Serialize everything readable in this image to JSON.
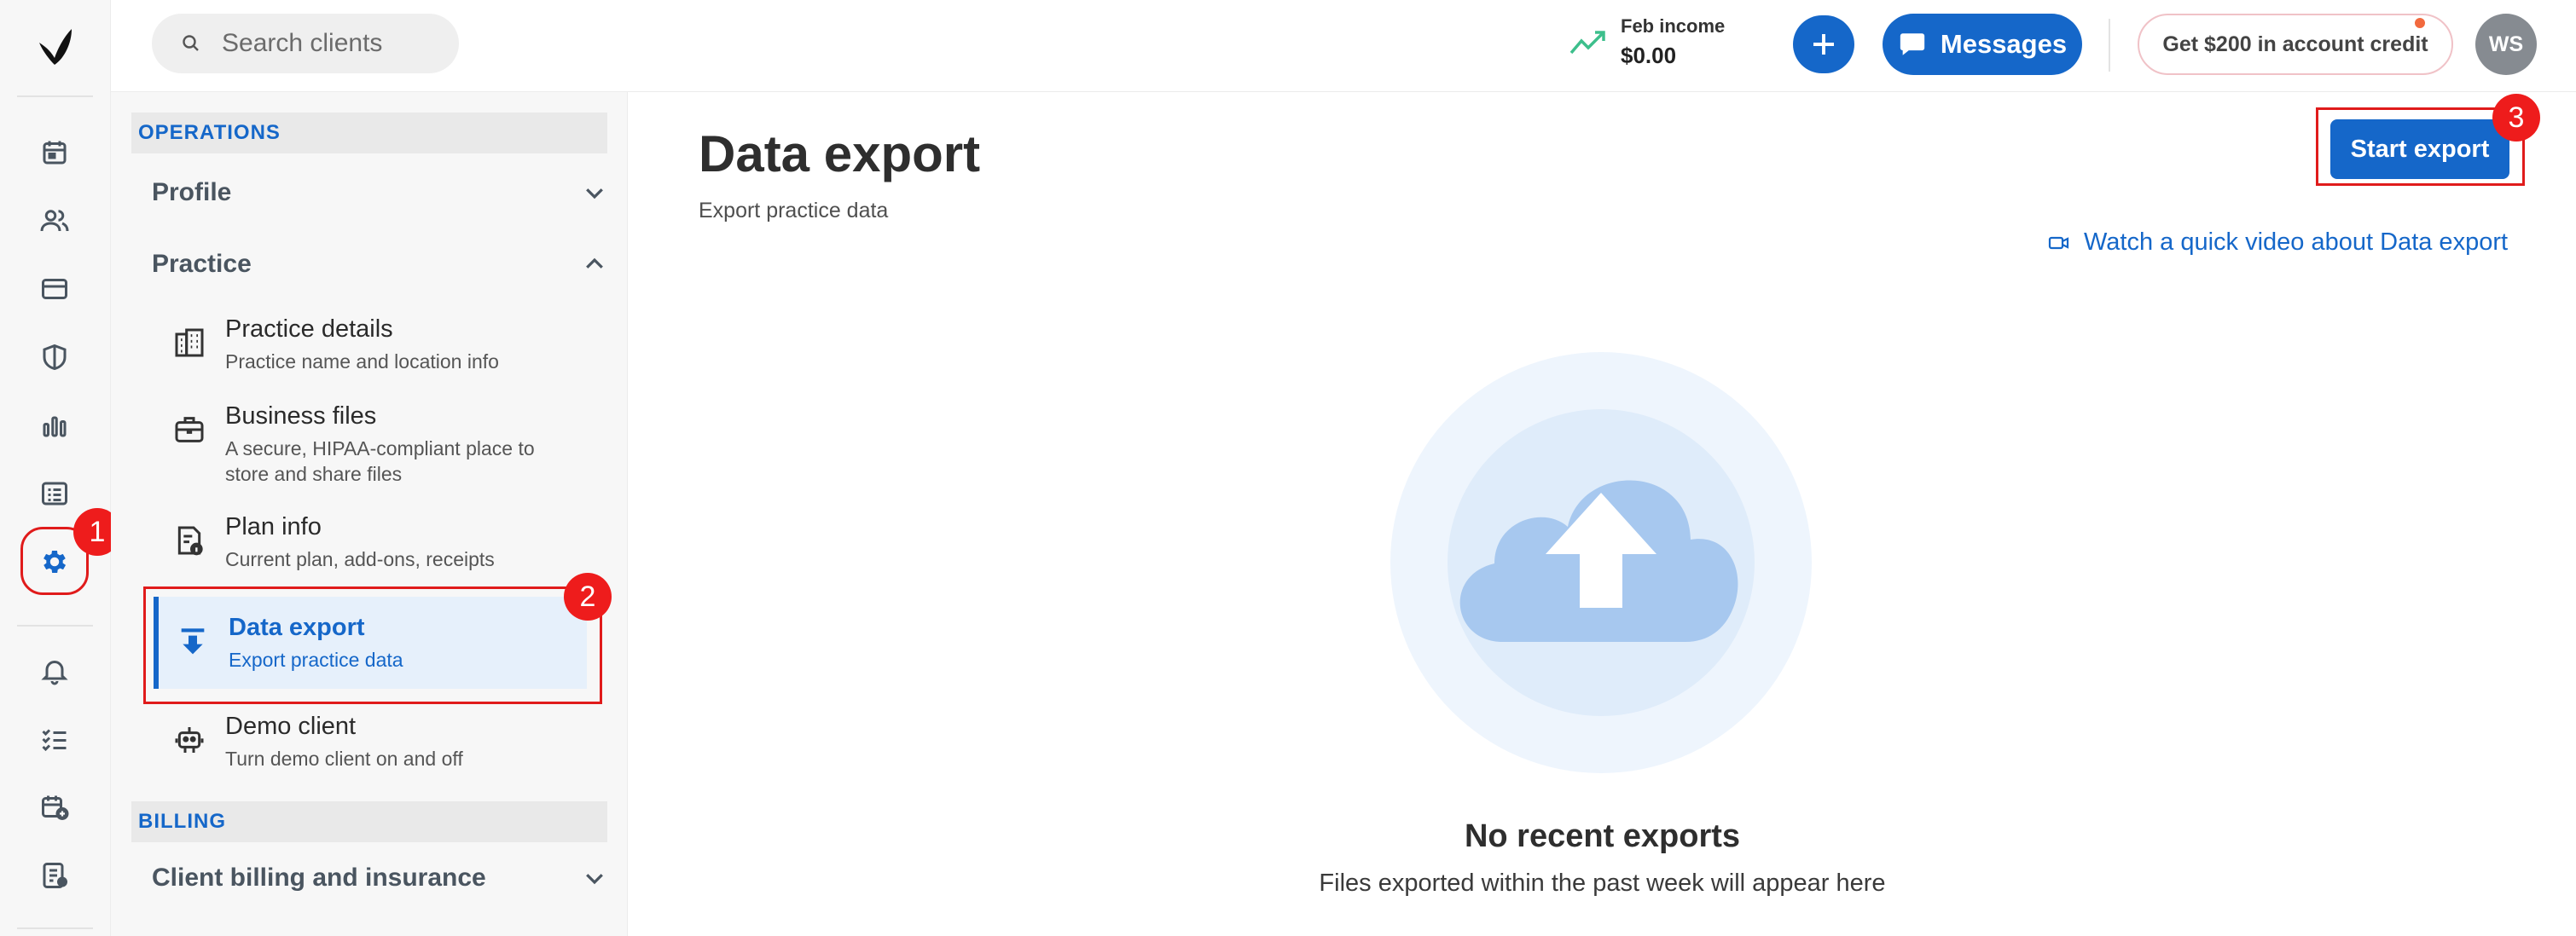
{
  "topbar": {
    "search_placeholder": "Search clients",
    "income_label": "Feb income",
    "income_value": "$0.00",
    "messages_label": "Messages",
    "credit_label": "Get $200 in account credit",
    "avatar_initials": "WS"
  },
  "annotations": {
    "one": "1",
    "two": "2",
    "three": "3"
  },
  "sidebar": {
    "operations_heading": "OPERATIONS",
    "profile_label": "Profile",
    "practice_label": "Practice",
    "items": [
      {
        "title": "Practice details",
        "subtitle": "Practice name and location info"
      },
      {
        "title": "Business files",
        "subtitle": "A secure, HIPAA-compliant place to store and share files"
      },
      {
        "title": "Plan info",
        "subtitle": "Current plan, add-ons, receipts"
      },
      {
        "title": "Data export",
        "subtitle": "Export practice data"
      },
      {
        "title": "Demo client",
        "subtitle": "Turn demo client on and off"
      }
    ],
    "billing_heading": "BILLING",
    "billing_group_label": "Client billing and insurance"
  },
  "main": {
    "title": "Data export",
    "subtitle": "Export practice data",
    "start_export_label": "Start export",
    "video_link_label": "Watch a quick video about Data export",
    "empty_title": "No recent exports",
    "empty_subtitle": "Files exported within the past week will appear here"
  },
  "colors": {
    "accent": "#1567c9",
    "annotation_red": "#ee1c1c"
  }
}
